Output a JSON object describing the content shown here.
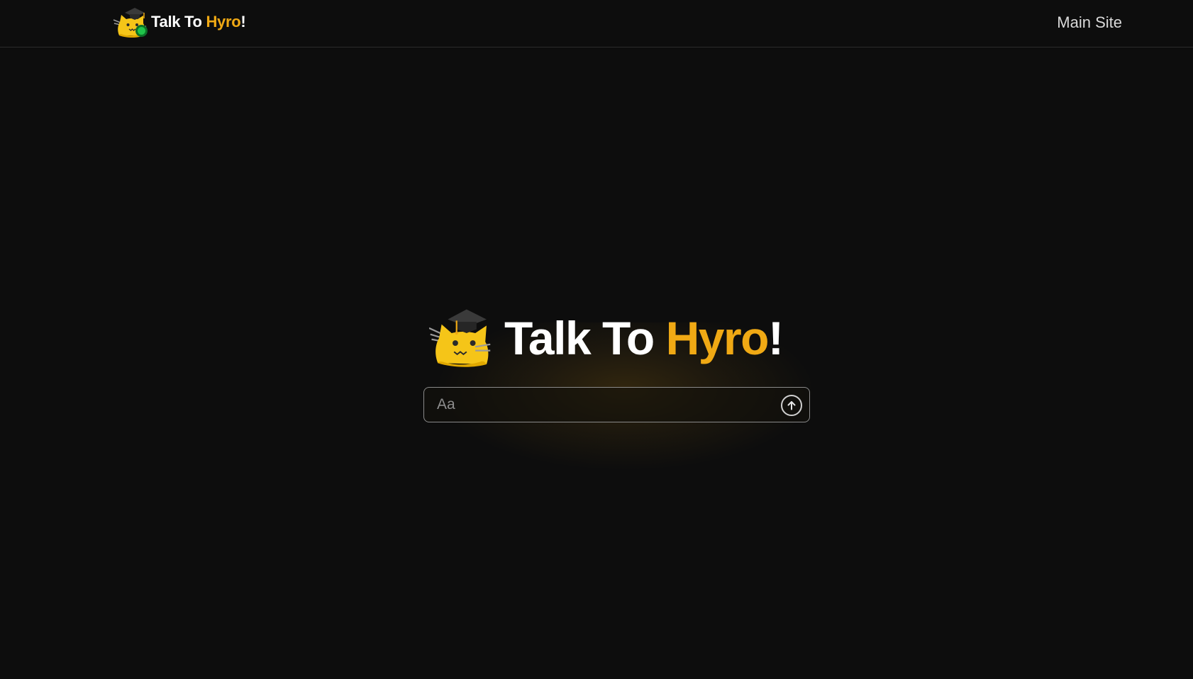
{
  "header": {
    "brand": {
      "part1": "Talk To ",
      "accent": "Hyro",
      "suffix": "!"
    },
    "nav_link": "Main Site"
  },
  "hero": {
    "title": {
      "part1": "Talk To ",
      "accent": "Hyro",
      "suffix": "!"
    }
  },
  "chat": {
    "placeholder": "Aa",
    "value": ""
  },
  "colors": {
    "background": "#0d0d0d",
    "accent": "#f0a914",
    "status_online": "#1fc44a",
    "text": "#ffffff"
  },
  "icons": {
    "logo": "graduation-cat-icon",
    "status": "online-status-icon",
    "send": "arrow-up-circle-icon"
  }
}
